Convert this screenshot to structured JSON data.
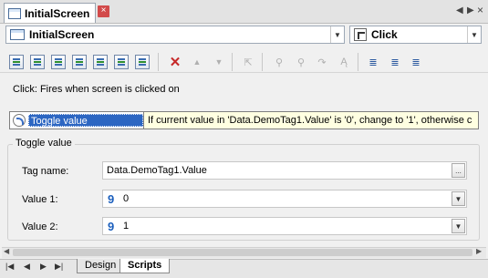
{
  "titlebar": {
    "tab_label": "InitialScreen",
    "close": "×",
    "prev": "◀",
    "next": "▶",
    "close_panel": "×"
  },
  "selectors": {
    "object": "InitialScreen",
    "event": "Click"
  },
  "toolbar": {
    "delete": "✕",
    "up": "▲",
    "down": "▼",
    "icon_names": [
      "add-action-icon",
      "insert-action-icon",
      "action-icon",
      "action-icon",
      "action-icon",
      "action-icon",
      "action-icon",
      "delete-icon",
      "move-up-icon",
      "move-down-icon",
      "pointer-icon",
      "find-icon",
      "find-next-icon",
      "replace-icon",
      "spell-icon",
      "outline-icon",
      "script-icon",
      "list-icon"
    ]
  },
  "description": "Click: Fires when screen is clicked on",
  "action": {
    "name": "Toggle value",
    "description": "If current value in 'Data.DemoTag1.Value' is '0', change to '1', otherwise c"
  },
  "group": {
    "title": "Toggle value",
    "tag_name_label": "Tag name:",
    "tag_name_value": "Data.DemoTag1.Value",
    "browse": "...",
    "value1_label": "Value 1:",
    "value1_type": "9",
    "value1": "0",
    "value2_label": "Value 2:",
    "value2_type": "9",
    "value2": "1"
  },
  "bottom": {
    "tabs": [
      "Design",
      "Scripts"
    ],
    "active_tab": "Scripts"
  }
}
